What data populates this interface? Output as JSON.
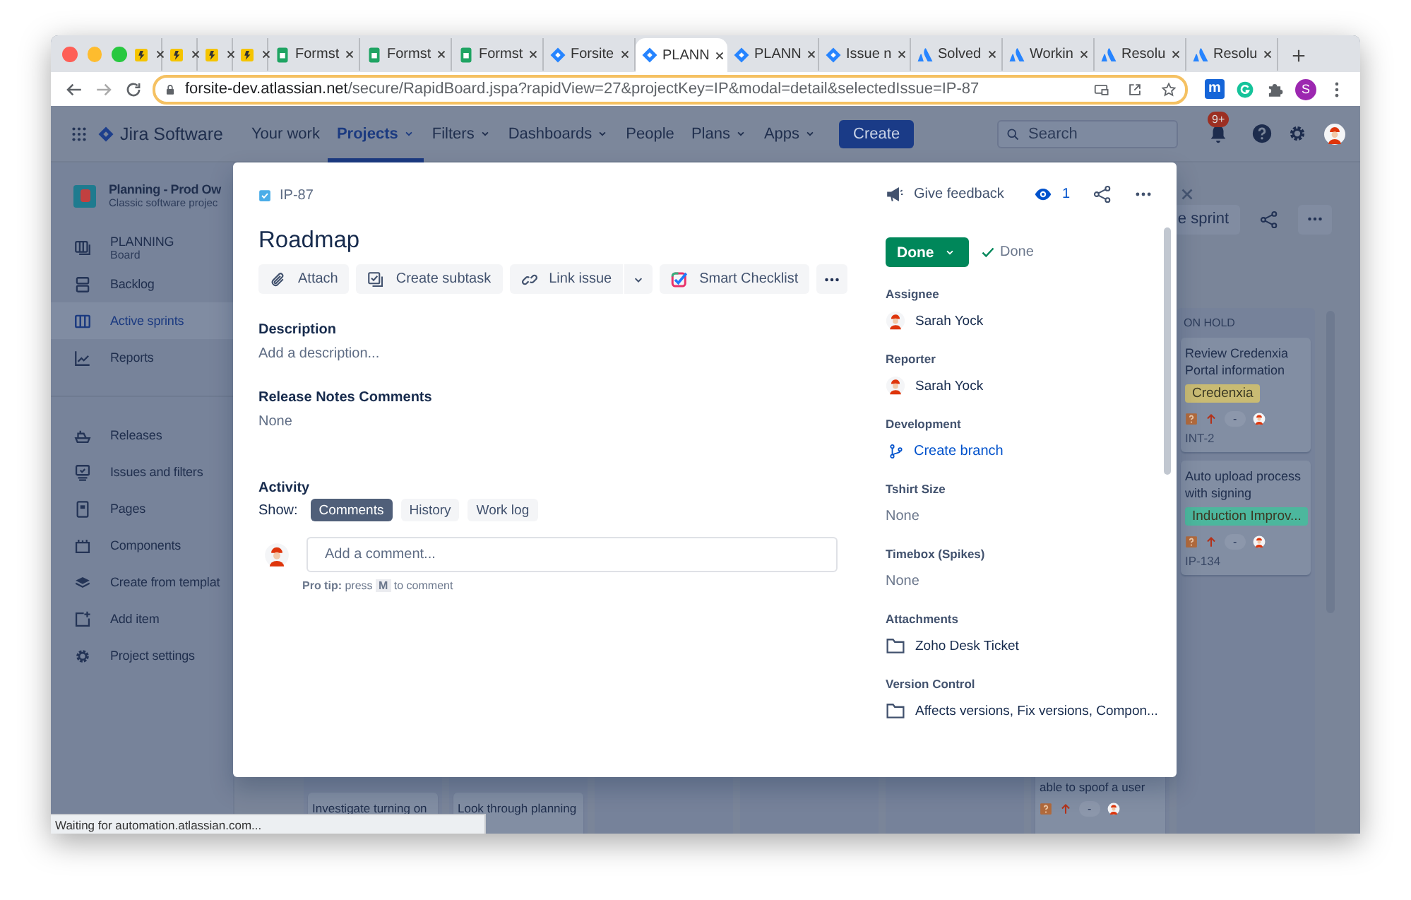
{
  "browser": {
    "tabs": [
      {
        "kind": "note",
        "selected": false
      },
      {
        "kind": "note",
        "selected": false
      },
      {
        "kind": "note",
        "selected": false
      },
      {
        "kind": "note",
        "selected": false
      },
      {
        "kind": "sheet",
        "title": "Formst",
        "selected": false
      },
      {
        "kind": "sheet",
        "title": "Formst",
        "selected": false
      },
      {
        "kind": "sheet",
        "title": "Formst",
        "selected": false
      },
      {
        "kind": "jira",
        "title": "Forsite",
        "selected": false
      },
      {
        "kind": "jira",
        "title": "PLANN",
        "selected": true
      },
      {
        "kind": "jira",
        "title": "PLANN",
        "selected": false
      },
      {
        "kind": "jira",
        "title": "Issue n",
        "selected": false
      },
      {
        "kind": "atlassian",
        "title": "Solved",
        "selected": false
      },
      {
        "kind": "atlassian",
        "title": "Workin",
        "selected": false
      },
      {
        "kind": "atlassian",
        "title": "Resolu",
        "selected": false
      },
      {
        "kind": "atlassian",
        "title": "Resolu",
        "selected": false
      }
    ],
    "url_host": "forsite-dev.atlassian.net",
    "url_path": "/secure/RapidBoard.jspa?rapidView=27&projectKey=IP&modal=detail&selectedIssue=IP-87",
    "extension_letter": "m",
    "profile_initial": "S"
  },
  "nav": {
    "product": "Jira Software",
    "items": [
      {
        "label": "Your work",
        "dropdown": false,
        "selected": false
      },
      {
        "label": "Projects",
        "dropdown": true,
        "selected": true
      },
      {
        "label": "Filters",
        "dropdown": true,
        "selected": false
      },
      {
        "label": "Dashboards",
        "dropdown": true,
        "selected": false
      },
      {
        "label": "People",
        "dropdown": false,
        "selected": false
      },
      {
        "label": "Plans",
        "dropdown": true,
        "selected": false
      },
      {
        "label": "Apps",
        "dropdown": true,
        "selected": false
      }
    ],
    "create": "Create",
    "search": {
      "placeholder": "Search"
    },
    "notifications": "9+"
  },
  "sidebar": {
    "project": {
      "name": "Planning - Prod Ow",
      "type": "Classic software projec"
    },
    "groups": [
      [
        {
          "label": "PLANNING",
          "sublabel": "Board",
          "selected": false
        },
        {
          "label": "Backlog",
          "selected": false
        },
        {
          "label": "Active sprints",
          "selected": true
        },
        {
          "label": "Reports",
          "selected": false
        }
      ],
      [
        {
          "label": "Releases",
          "selected": false
        },
        {
          "label": "Issues and filters",
          "selected": false
        },
        {
          "label": "Pages",
          "selected": false
        },
        {
          "label": "Components",
          "selected": false
        },
        {
          "label": "Create from templat",
          "selected": false
        },
        {
          "label": "Add item",
          "selected": false
        },
        {
          "label": "Project settings",
          "selected": false
        }
      ]
    ]
  },
  "board": {
    "sprint_button": "e sprint",
    "columns": [
      {
        "cards": [
          {
            "title": "Investigate turning on"
          }
        ]
      },
      {
        "cards": [
          {
            "title": "Look through planning"
          }
        ]
      },
      {},
      {},
      {},
      {
        "cards": [
          {
            "title": "able to spoof a user",
            "estimate": "-"
          }
        ]
      },
      {
        "title": "ON HOLD",
        "cards": [
          {
            "title": "Review Credenxia Portal information",
            "tag": {
              "label": "Credenxia",
              "color": "#c9bb73"
            },
            "estimate": "-",
            "key": "INT-2"
          },
          {
            "title": "Auto upload process with signing",
            "tag": {
              "label": "Induction Improv...",
              "color": "#4cb79d"
            },
            "estimate": "-",
            "key": "IP-134"
          }
        ]
      }
    ]
  },
  "modal": {
    "issue_key": "IP-87",
    "title": "Roadmap",
    "actions": [
      {
        "label": "Attach"
      },
      {
        "label": "Create subtask"
      },
      {
        "label": "Link issue",
        "split": true
      },
      {
        "label": "Smart Checklist"
      }
    ],
    "sections": [
      {
        "heading": "Description",
        "placeholder": "Add a description..."
      },
      {
        "heading": "Release Notes Comments",
        "value": "None"
      }
    ],
    "activity": {
      "heading": "Activity",
      "show_label": "Show:",
      "filters": [
        {
          "label": "Comments",
          "selected": true
        },
        {
          "label": "History",
          "selected": false
        },
        {
          "label": "Work log",
          "selected": false
        }
      ],
      "comment": {
        "placeholder": "Add a comment..."
      },
      "pro_tip": {
        "label": "Pro tip:",
        "before": "press",
        "key": "M",
        "after": "to comment"
      }
    },
    "feedback": "Give feedback",
    "watchers": "1",
    "status": {
      "button": "Done",
      "resolution": "Done"
    },
    "fields": [
      {
        "label": "Assignee",
        "kind": "user",
        "value": "Sarah Yock"
      },
      {
        "label": "Reporter",
        "kind": "user",
        "value": "Sarah Yock"
      },
      {
        "label": "Development",
        "kind": "link",
        "value": "Create branch"
      },
      {
        "label": "Tshirt Size",
        "kind": "text",
        "value": "None"
      },
      {
        "label": "Timebox (Spikes)",
        "kind": "text",
        "value": "None"
      },
      {
        "label": "Attachments",
        "kind": "folder",
        "value": "Zoho Desk Ticket"
      },
      {
        "label": "Version Control",
        "kind": "folder",
        "value": "Affects versions, Fix versions, Compon..."
      }
    ]
  },
  "status_bar": "Waiting for automation.atlassian.com..."
}
